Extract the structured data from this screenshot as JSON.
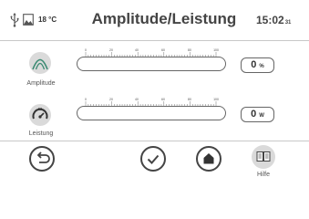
{
  "header": {
    "temperature": "18 °C",
    "title": "Amplitude/Leistung",
    "clock": "15:02",
    "clock_seconds": "31"
  },
  "rows": [
    {
      "label": "Amplitude",
      "value": "0",
      "unit": "%",
      "slider_level": 0,
      "scale_labels": [
        "0",
        "20",
        "40",
        "60",
        "80",
        "100"
      ],
      "icon": "amplitude-icon"
    },
    {
      "label": "Leistung",
      "value": "0",
      "unit": "W",
      "slider_level": 0,
      "scale_labels": [
        "0",
        "20",
        "40",
        "60",
        "80",
        "100"
      ],
      "icon": "power-gauge-icon"
    }
  ],
  "footer": {
    "help_label": "Hilfe",
    "back_icon": "back-icon",
    "confirm_icon": "check-icon",
    "home_icon": "home-icon",
    "help_icon": "book-icon"
  },
  "colors": {
    "accent": "#3a8a72",
    "icon_bg": "#dadada",
    "outline": "#666666"
  }
}
